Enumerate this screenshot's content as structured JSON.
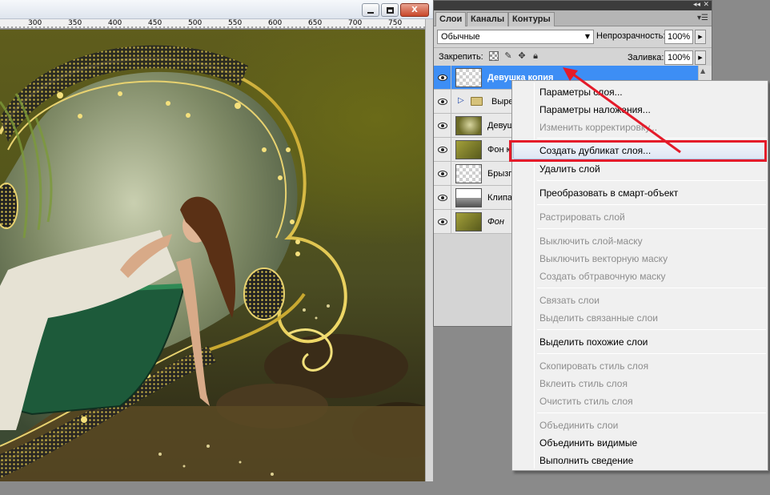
{
  "document": {
    "ruler_labels": [
      "300",
      "350",
      "400",
      "450",
      "500",
      "550",
      "600",
      "650",
      "700",
      "750"
    ],
    "window_buttons": {
      "close": "X"
    }
  },
  "layers_panel": {
    "tabs": [
      "Слои",
      "Каналы",
      "Контуры"
    ],
    "blend_mode": "Обычные",
    "opacity_label": "Непрозрачность:",
    "opacity_value": "100%",
    "lock_label": "Закрепить:",
    "fill_label": "Заливка:",
    "fill_value": "100%",
    "layers": [
      {
        "name": "Девушка копия",
        "thumb": "transparent",
        "selected": true,
        "visible": true
      },
      {
        "name": "Выре",
        "thumb": "group",
        "selected": false,
        "visible": true
      },
      {
        "name": "Девуш",
        "thumb": "photo",
        "selected": false,
        "visible": true
      },
      {
        "name": "Фон к",
        "thumb": "background",
        "selected": false,
        "visible": true
      },
      {
        "name": "Брызг",
        "thumb": "transparent",
        "selected": false,
        "visible": true
      },
      {
        "name": "Клипа",
        "thumb": "clip",
        "selected": false,
        "visible": true
      },
      {
        "name": "Фон",
        "thumb": "background",
        "selected": false,
        "visible": true,
        "italic": true
      }
    ]
  },
  "context_menu": {
    "items": [
      {
        "label": "Параметры слоя...",
        "enabled": true
      },
      {
        "label": "Параметры наложения...",
        "enabled": true
      },
      {
        "label": "Изменить корректировку...",
        "enabled": false
      },
      {
        "label": "Создать дубликат слоя...",
        "enabled": true,
        "highlighted": true
      },
      {
        "label": "Удалить слой",
        "enabled": true
      },
      {
        "label": "Преобразовать в смарт-объект",
        "enabled": true
      },
      {
        "label": "Растрировать слой",
        "enabled": false
      },
      {
        "label": "Выключить слой-маску",
        "enabled": false
      },
      {
        "label": "Выключить векторную маску",
        "enabled": false
      },
      {
        "label": "Создать обтравочную маску",
        "enabled": false
      },
      {
        "label": "Связать слои",
        "enabled": false
      },
      {
        "label": "Выделить связанные слои",
        "enabled": false
      },
      {
        "label": "Выделить похожие слои",
        "enabled": true
      },
      {
        "label": "Скопировать стиль слоя",
        "enabled": false
      },
      {
        "label": "Вклеить стиль слоя",
        "enabled": false
      },
      {
        "label": "Очистить стиль слоя",
        "enabled": false
      },
      {
        "label": "Объединить слои",
        "enabled": false
      },
      {
        "label": "Объединить видимые",
        "enabled": true
      },
      {
        "label": "Выполнить сведение",
        "enabled": true
      }
    ]
  },
  "colors": {
    "selection_blue": "#3d8ef5",
    "annotation_red": "#e41b2a",
    "frame_gold": "#d9c040"
  },
  "icons": {
    "layer_visibility": "eye-icon",
    "lock_transparent": "checkerboard-icon",
    "lock_pixels": "brush-icon",
    "lock_position": "move-icon",
    "lock_all": "padlock-icon",
    "group": "folder-icon"
  }
}
